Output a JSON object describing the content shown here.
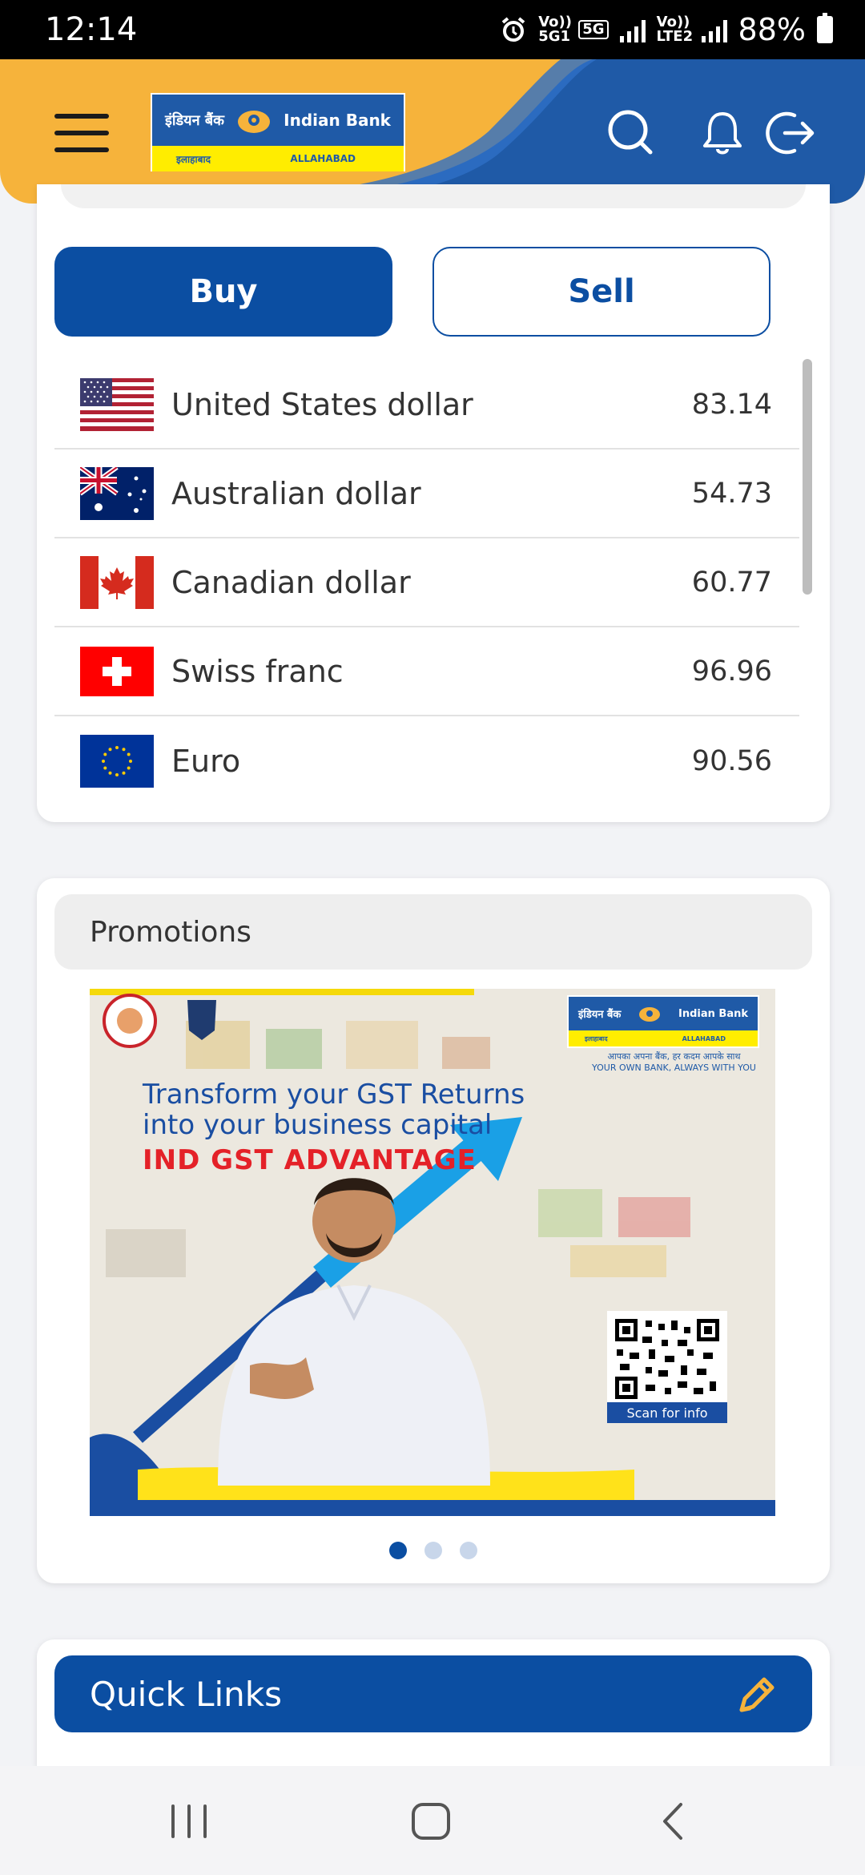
{
  "status_bar": {
    "time": "12:14",
    "network1": "Vo)) 5G1",
    "network_5g": "5G",
    "network2": "Vo)) LTE2",
    "battery": "88%"
  },
  "header": {
    "logo_hindi": "इंडियन बैंक",
    "logo_english": "Indian Bank",
    "logo_sub_hindi": "इलाहाबाद",
    "logo_sub_english": "ALLAHABAD",
    "icons": [
      "menu-icon",
      "search-icon",
      "bell-icon",
      "logout-icon"
    ]
  },
  "forex": {
    "buy_label": "Buy",
    "sell_label": "Sell",
    "selected": "Buy",
    "rates": [
      {
        "currency": "United States dollar",
        "value": "83.14",
        "flag": "us"
      },
      {
        "currency": "Australian dollar",
        "value": "54.73",
        "flag": "au"
      },
      {
        "currency": "Canadian dollar",
        "value": "60.77",
        "flag": "ca"
      },
      {
        "currency": "Swiss franc",
        "value": "96.96",
        "flag": "ch"
      },
      {
        "currency": "Euro",
        "value": "90.56",
        "flag": "eu"
      }
    ]
  },
  "promotions": {
    "title": "Promotions",
    "banner": {
      "line1": "Transform your GST Returns",
      "line2": "into your business capital",
      "headline": "IND GST ADVANTAGE",
      "logo_hindi": "इंडियन बैंक",
      "logo_english": "Indian Bank",
      "logo_sub_hindi": "इलाहाबाद",
      "logo_sub_english": "ALLAHABAD",
      "tagline_hindi": "आपका अपना बैंक, हर कदम आपके साथ",
      "tagline_english": "YOUR OWN BANK, ALWAYS WITH YOU",
      "qr_label": "Scan for info"
    },
    "slides": 3,
    "active_slide": 1
  },
  "quick_links": {
    "title": "Quick Links"
  },
  "colors": {
    "primary": "#0b4ea2",
    "header_yellow": "#f6b33b",
    "header_blue": "#1f5aa7"
  }
}
